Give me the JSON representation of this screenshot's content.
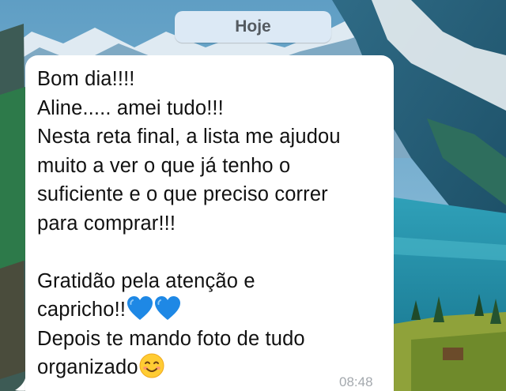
{
  "date_separator": {
    "label": "Hoje"
  },
  "message": {
    "lines": [
      "Bom dia!!!!",
      "Aline..... amei tudo!!!",
      "Nesta reta final, a lista me ajudou",
      "muito a ver o que já tenho o",
      "suficiente e o que preciso correr",
      "para comprar!!!",
      "",
      "Gratidão pela atenção e",
      "capricho!!",
      "Depois te mando foto de tudo",
      "organizado"
    ],
    "emojis": {
      "line_9": [
        "blue-heart",
        "blue-heart"
      ],
      "line_11": [
        "smiling-face"
      ]
    },
    "time": "08:48",
    "direction": "incoming"
  },
  "colors": {
    "bubble": "#ffffff",
    "date_pill": "#dce9f5",
    "date_text": "#545a60",
    "timestamp": "#a4a9ae",
    "heart": "#1e88e5"
  }
}
